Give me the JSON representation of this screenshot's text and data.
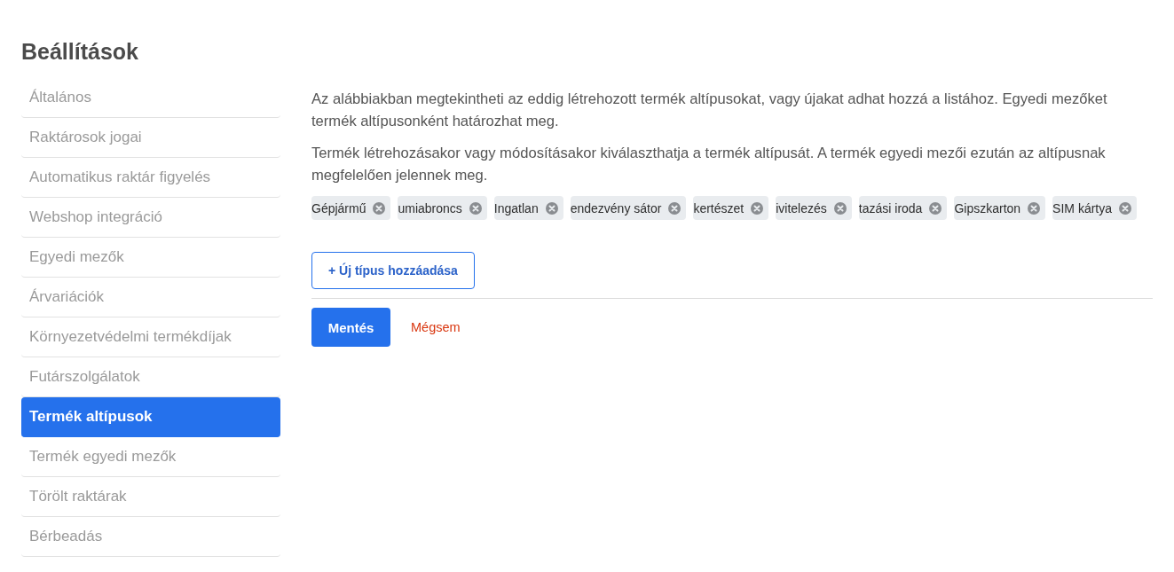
{
  "page": {
    "title": "Beállítások"
  },
  "sidebar": {
    "items": [
      {
        "label": "Általános",
        "selected": false
      },
      {
        "label": "Raktárosok jogai",
        "selected": false
      },
      {
        "label": "Automatikus raktár figyelés",
        "selected": false
      },
      {
        "label": "Webshop integráció",
        "selected": false
      },
      {
        "label": "Egyedi mezők",
        "selected": false
      },
      {
        "label": "Árvariációk",
        "selected": false
      },
      {
        "label": "Környezetvédelmi termékdíjak",
        "selected": false
      },
      {
        "label": "Futárszolgálatok",
        "selected": false
      },
      {
        "label": "Termék altípusok",
        "selected": true
      },
      {
        "label": "Termék egyedi mezők",
        "selected": false
      },
      {
        "label": "Törölt raktárak",
        "selected": false
      },
      {
        "label": "Bérbeadás",
        "selected": false
      }
    ]
  },
  "content": {
    "paragraphs": [
      "Az alábbiakban megtekintheti az eddig létrehozott termék altípusokat, vagy újakat adhat hozzá a listához. Egyedi mezőket termék altípusonként határozhat meg.",
      "Termék létrehozásakor vagy módosításakor kiválaszthatja a termék altípusát. A termék egyedi mezői ezután az altípusnak megfelelően jelennek meg."
    ],
    "tags": [
      {
        "label": "Gépjármű"
      },
      {
        "label": "umiabroncs"
      },
      {
        "label": "Ingatlan"
      },
      {
        "label": "endezvény sátor"
      },
      {
        "label": "kertészet"
      },
      {
        "label": "ivitelezés"
      },
      {
        "label": "tazási iroda"
      },
      {
        "label": "Gipszkarton"
      },
      {
        "label": "SIM kártya"
      }
    ],
    "add_button": "+ Új típus hozzáadása",
    "save_button": "Mentés",
    "cancel_button": "Mégsem"
  }
}
